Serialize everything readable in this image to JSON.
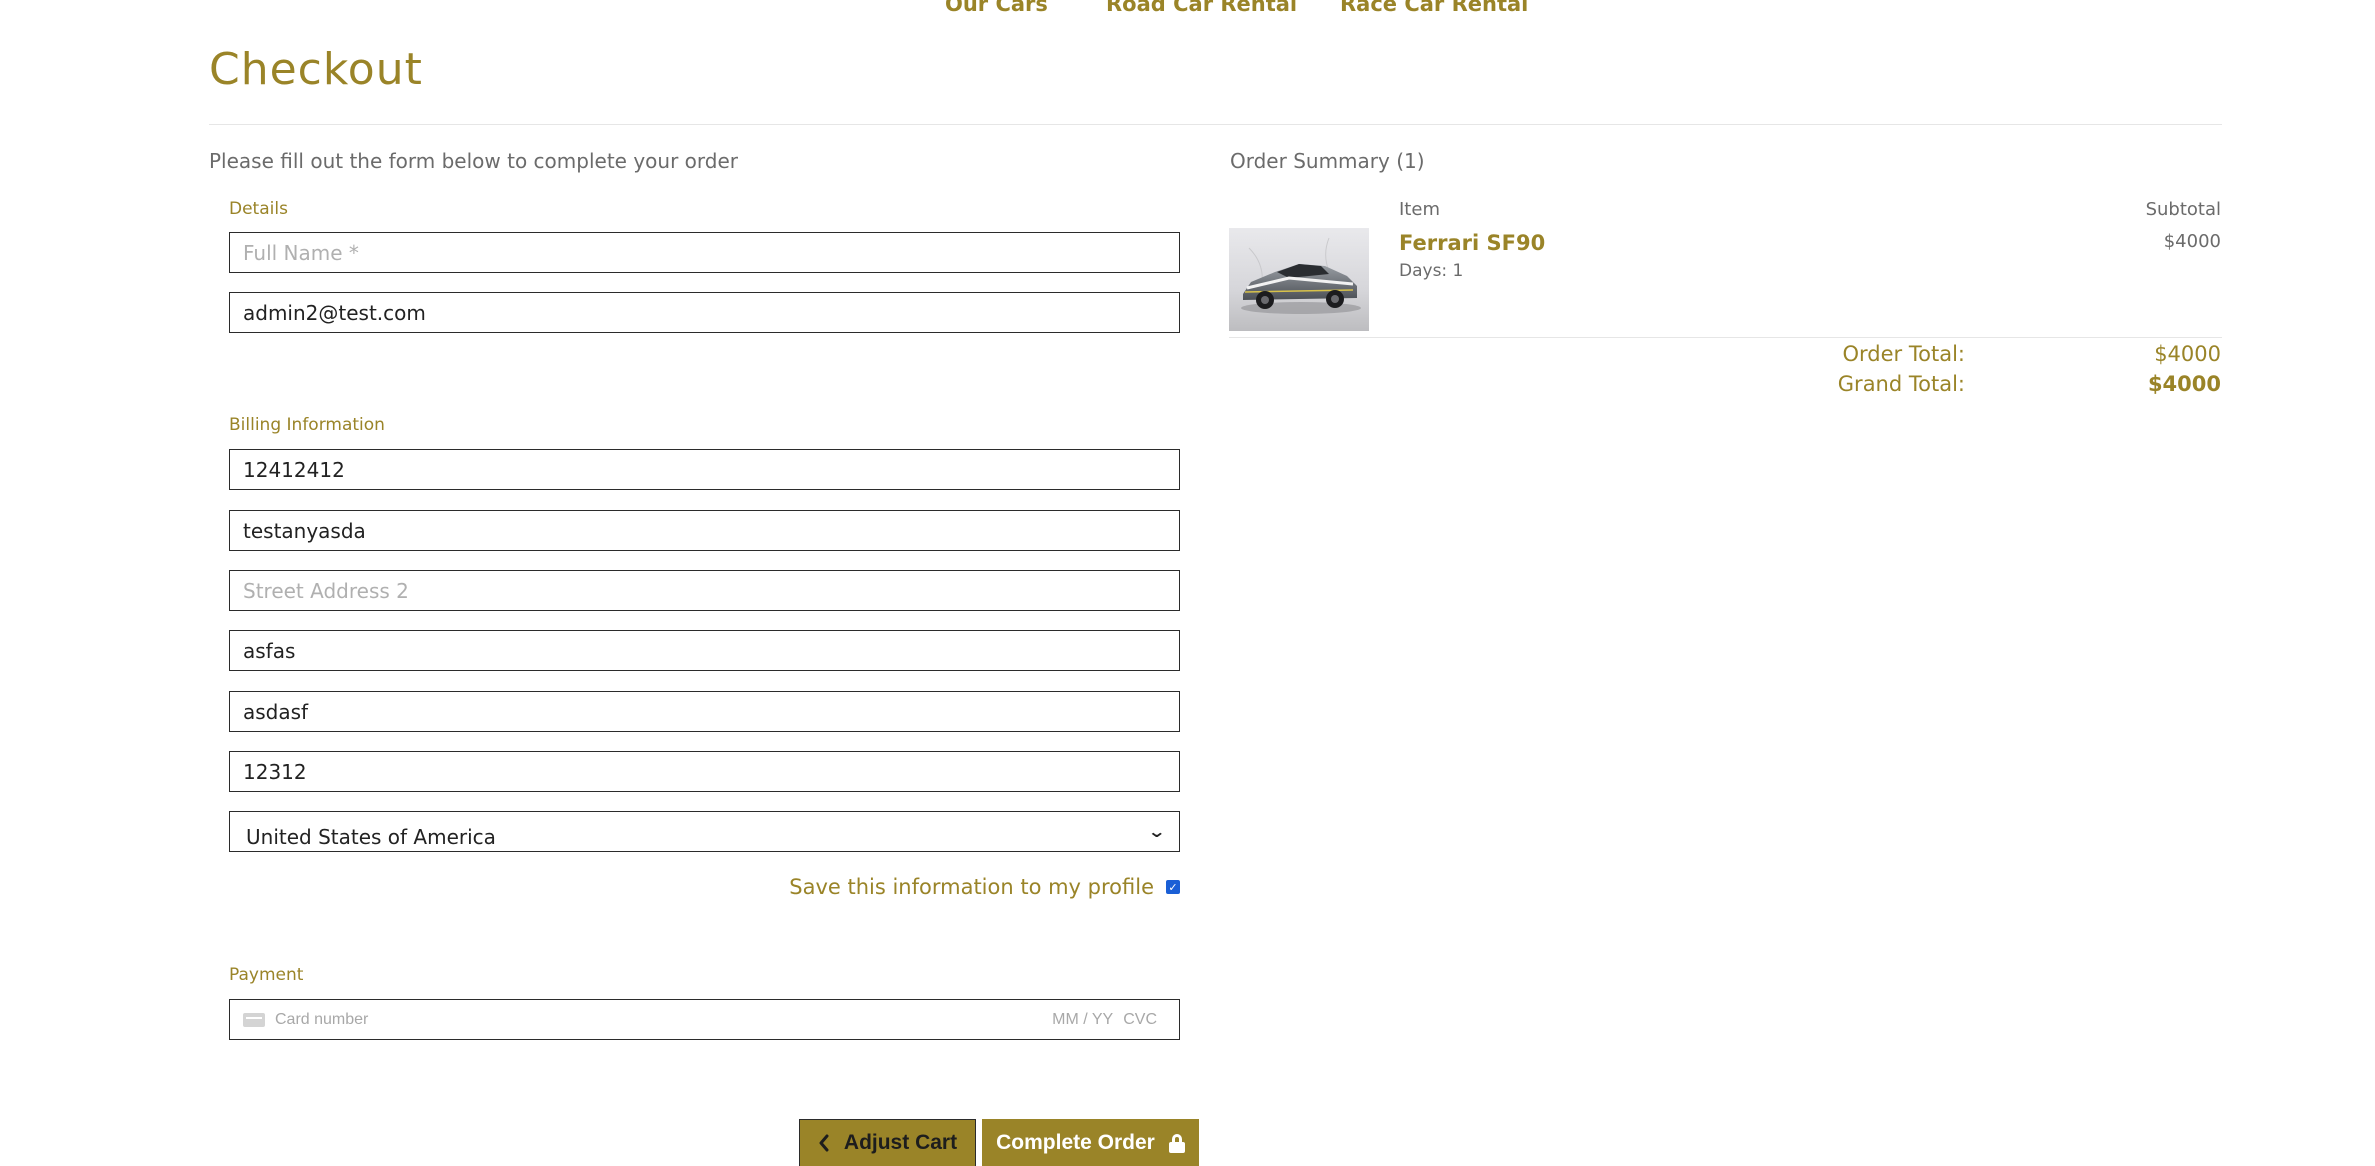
{
  "nav": {
    "items": [
      "Our Cars",
      "Road Car Rental",
      "Race Car Rental"
    ]
  },
  "page": {
    "title": "Checkout",
    "intro": "Please fill out the form below to complete your order"
  },
  "details": {
    "label": "Details",
    "full_name": {
      "value": "",
      "placeholder": "Full Name *"
    },
    "email": {
      "value": "admin2@test.com"
    }
  },
  "billing": {
    "label": "Billing Information",
    "phone": {
      "value": "12412412"
    },
    "street1": {
      "value": "testanyasda"
    },
    "street2": {
      "value": "",
      "placeholder": "Street Address 2"
    },
    "city": {
      "value": "asfas"
    },
    "county": {
      "value": "asdasf"
    },
    "postcode": {
      "value": "12312"
    },
    "country": {
      "selected": "United States of America"
    },
    "save_label": "Save this information to my profile",
    "save_checked": true
  },
  "payment": {
    "label": "Payment",
    "card_placeholder": "Card number",
    "expiry_placeholder": "MM / YY",
    "cvc_placeholder": "CVC"
  },
  "buttons": {
    "adjust_cart": "Adjust Cart",
    "complete_order": "Complete Order"
  },
  "summary": {
    "title": "Order Summary (1)",
    "col_item": "Item",
    "col_subtotal": "Subtotal",
    "items": [
      {
        "name": "Ferrari SF90",
        "days": "Days: 1",
        "subtotal": "$4000"
      }
    ],
    "order_total_label": "Order Total:",
    "order_total": "$4000",
    "grand_total_label": "Grand Total:",
    "grand_total": "$4000"
  },
  "colors": {
    "accent": "#9a8428",
    "text_muted": "#6b6b6b",
    "border": "#2b2b2b"
  }
}
